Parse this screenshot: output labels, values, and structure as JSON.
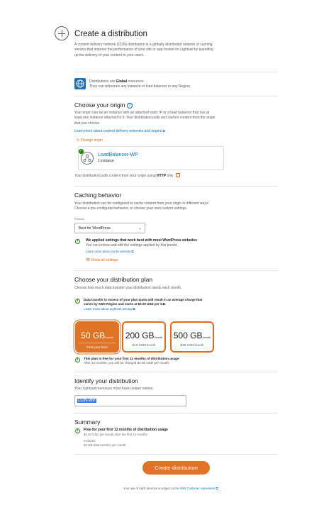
{
  "header": {
    "title": "Create a distribution",
    "description": "A content delivery network (CDN) distribution is a globally distributed network of caching servers that improve the performance of your site or app hosted on Lightsail by speeding up the delivery of your content to your users."
  },
  "notice": {
    "line1_prefix": "Distributions are ",
    "line1_bold": "Global",
    "line1_suffix": " resources.",
    "line2": "They can reference any instance or load balancer in any Region."
  },
  "origin": {
    "title": "Choose your origin",
    "help": "?",
    "description": "Your origin can be an instance with an attached static IP or a load balancer that has at least one instance attached to it. Your distribution pulls and caches content from the origin that you choose.",
    "learn_more": "Learn more about content delivery networks and origins",
    "change_link": "Change origin",
    "card_name": "LoadBalancer-WP",
    "card_sub": "1 instance",
    "pull_prefix": "Your distribution pulls content from your origin using ",
    "pull_protocol": "HTTP",
    "pull_suffix": " only"
  },
  "caching": {
    "title": "Caching behavior",
    "description": "Your distribution can be configured to cache content from your origin in different ways. Choose a pre-configured behavior, or choose your own custom settings.",
    "preset_label": "Presets",
    "preset_value": "Best for WordPress",
    "applied_title": "We applied settings that work best with most WordPress websites",
    "applied_sub": "You can review and edit the settings applied by this preset.",
    "learn_presets": "Learn more about cache presets",
    "show_all": "Show all settings"
  },
  "plan": {
    "title": "Choose your distribution plan",
    "description": "Choose how much data transfer your distribution needs each month.",
    "warning": "Data transfer in excess of your plan quota will result in an average charge that varies by AWS Region and starts at $0.09 USD per GB.",
    "warning_link": "Learn more about Lightsail pricing",
    "plans": [
      {
        "size": "50 GB",
        "unit": "/month",
        "price": "First year free!"
      },
      {
        "size": "200 GB",
        "unit": "/month",
        "price": "$10 USD/month"
      },
      {
        "size": "500 GB",
        "unit": "/month",
        "price": "$35 USD/month"
      }
    ],
    "free_title": "This plan is free for your first 12 months of distribution usage",
    "free_sub": "After 12 months, you will be charged $2.50 USD per month."
  },
  "identify": {
    "title": "Identify your distribution",
    "description": "Your Lightsail resources must have unique names.",
    "name_value": "CDN-WP"
  },
  "summary": {
    "title": "Summary",
    "free_title": "Free for your first 12 months of distribution usage",
    "free_sub": "$2.50 USD per month after the first 12 months.",
    "includes_label": "Includes:",
    "includes_value": "50 GB data transfer per month"
  },
  "actions": {
    "create": "Create distribution"
  },
  "footer": {
    "prefix": "Your use of AWS services is subject to the ",
    "link": "AWS Customer Agreement"
  },
  "colors": {
    "accent": "#e57126",
    "link": "#0073bb",
    "success": "#1d8102",
    "globe": "#1f6fb5"
  }
}
